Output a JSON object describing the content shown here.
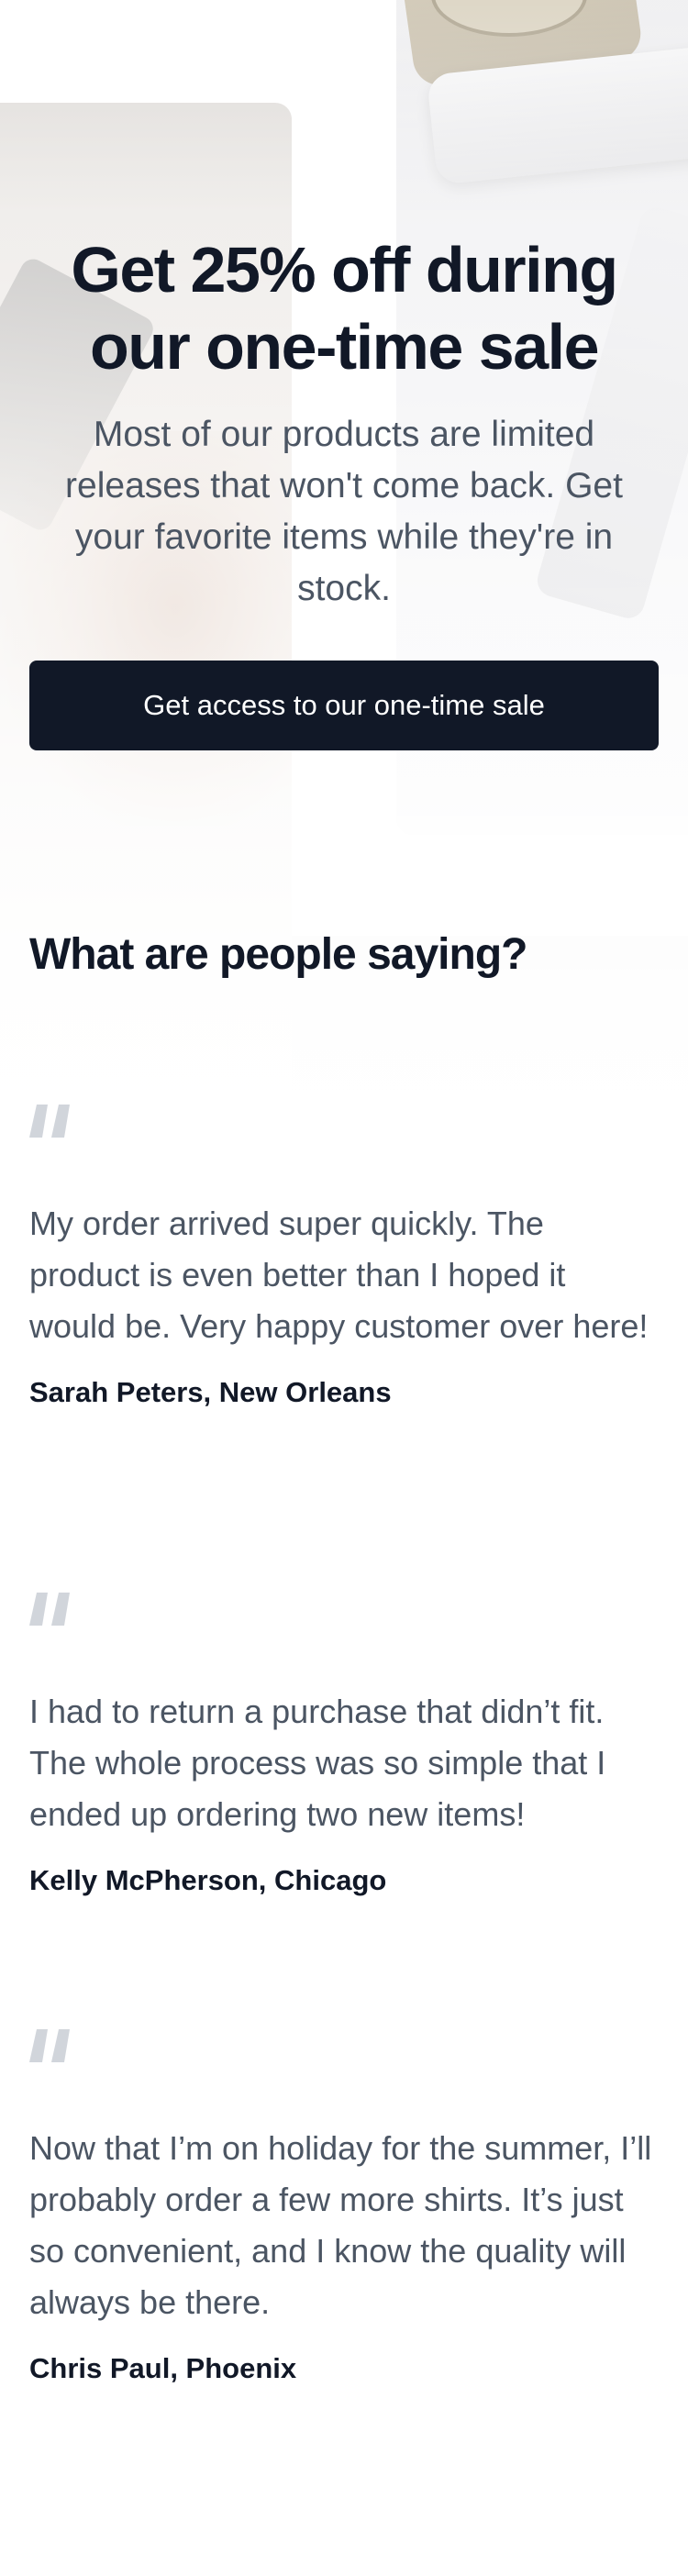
{
  "hero": {
    "title": "Get 25% off during our one-time sale",
    "subtitle": "Most of our products are limited releases that won't come back. Get your favorite items while they're in stock.",
    "cta_label": "Get access to our one-time sale"
  },
  "testimonials": {
    "heading": "What are people saying?",
    "items": [
      {
        "quote": "My order arrived super quickly. The product is even better than I hoped it would be. Very happy customer over here!",
        "author": "Sarah Peters, New Orleans"
      },
      {
        "quote": "I had to return a purchase that didn’t fit. The whole process was so simple that I ended up ordering two new items!",
        "author": "Kelly McPherson, Chicago"
      },
      {
        "quote": "Now that I’m on holiday for the summer, I’ll probably order a few more shirts. It’s just so convenient, and I know the quality will always be there.",
        "author": "Chris Paul, Phoenix"
      }
    ]
  },
  "colors": {
    "primary": "#111827",
    "body_text": "#4b5563",
    "quote_icon": "#d1d5db",
    "background": "#ffffff"
  },
  "icons": {
    "quote": "quote-icon"
  }
}
